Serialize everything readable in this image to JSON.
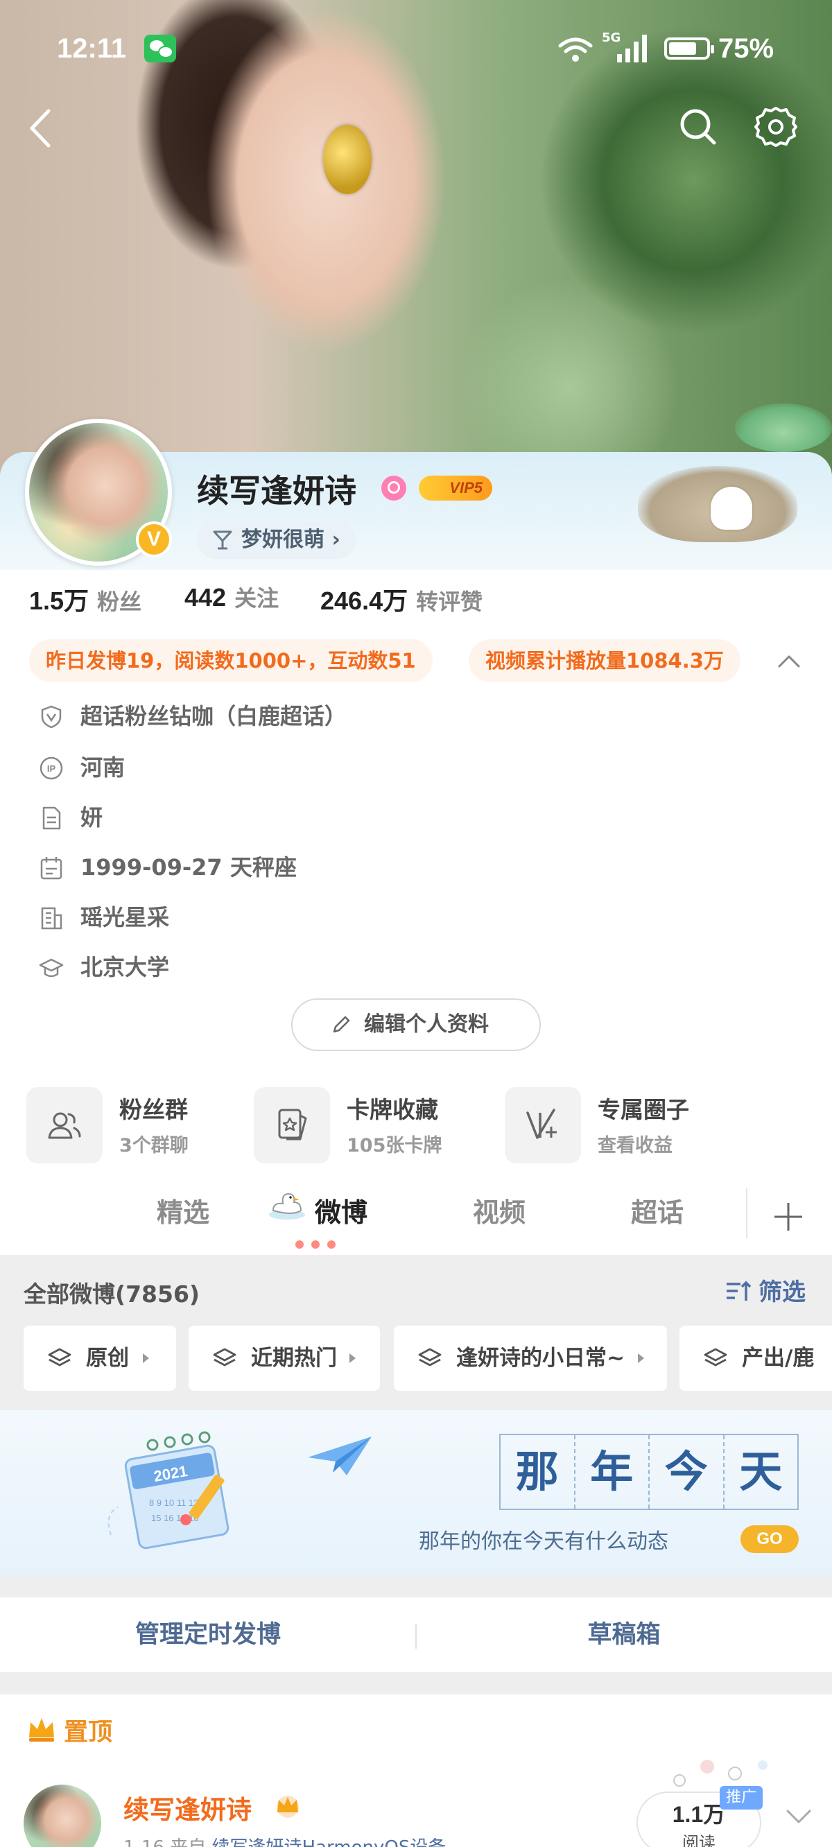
{
  "status_bar": {
    "time": "12:11",
    "network": "5G",
    "battery_text": "75%",
    "battery_level": 0.75
  },
  "profile": {
    "name": "续写逢妍诗",
    "vip_label": "VIP5",
    "group_tag": "梦妍很萌",
    "stats": [
      {
        "value": "1.5万",
        "label": "粉丝"
      },
      {
        "value": "442",
        "label": "关注"
      },
      {
        "value": "246.4万",
        "label": "转评赞"
      }
    ],
    "highlights": [
      "昨日发博19，阅读数1000+，互动数51",
      "视频累计播放量1084.3万"
    ],
    "info": [
      {
        "icon": "shield-v-icon",
        "text": "超话粉丝钻咖（白鹿超话）"
      },
      {
        "icon": "ip-icon",
        "text": "河南"
      },
      {
        "icon": "document-icon",
        "text": "妍"
      },
      {
        "icon": "calendar-icon",
        "text": "1999-09-27  天秤座"
      },
      {
        "icon": "company-icon",
        "text": "瑶光星采"
      },
      {
        "icon": "graduation-cap-icon",
        "text": "北京大学"
      }
    ],
    "edit_button": "编辑个人资料"
  },
  "features": [
    {
      "icon": "fans-group-icon",
      "title": "粉丝群",
      "subtitle": "3个群聊"
    },
    {
      "icon": "card-collection-icon",
      "title": "卡牌收藏",
      "subtitle": "105张卡牌"
    },
    {
      "icon": "exclusive-circle-icon",
      "title": "专属圈子",
      "subtitle": "查看收益"
    }
  ],
  "tabs": [
    {
      "label": "精选",
      "active": false
    },
    {
      "label": "微博",
      "active": true
    },
    {
      "label": "视频",
      "active": false
    },
    {
      "label": "超话",
      "active": false
    }
  ],
  "feed": {
    "count_label": "全部微博(7856)",
    "filter_label": "筛选",
    "chips": [
      "原创",
      "近期热门",
      "逢妍诗的小日常~",
      "产出/鹿"
    ]
  },
  "banner": {
    "calendar_year": "2021",
    "title_chars": [
      "那",
      "年",
      "今",
      "天"
    ],
    "subtitle": "那年的你在今天有什么动态",
    "go_label": "GO"
  },
  "actions": [
    "管理定时发博",
    "草稿箱"
  ],
  "pinned": {
    "label": "置顶",
    "author": "续写逢妍诗",
    "meta_prefix": "1-16  来自 ",
    "meta_link": "续写逢妍诗HarmonyOS设备",
    "read_count": "1.1万",
    "read_label": "阅读",
    "promo_label": "推广"
  },
  "colors": {
    "accent_orange": "#f26b1d",
    "link_blue": "#4e6ea3",
    "vip_gold": "#ffcc33"
  }
}
